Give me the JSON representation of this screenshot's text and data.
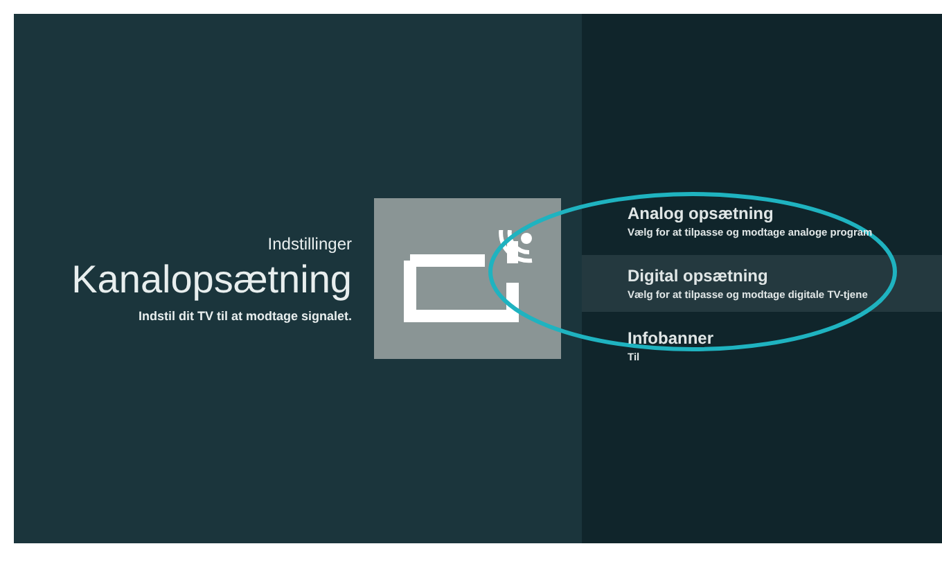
{
  "header": {
    "breadcrumb": "Indstillinger",
    "title": "Kanalopsætning",
    "subtitle": "Indstil dit TV til at modtage signalet."
  },
  "menu_items": [
    {
      "title": "Analog opsætning",
      "description": "Vælg for at tilpasse og modtage analoge program",
      "selected": false
    },
    {
      "title": "Digital opsætning",
      "description": "Vælg for at tilpasse og modtage digitale TV-tjene",
      "selected": true
    },
    {
      "title": "Infobanner",
      "description": "Til",
      "selected": false
    }
  ]
}
